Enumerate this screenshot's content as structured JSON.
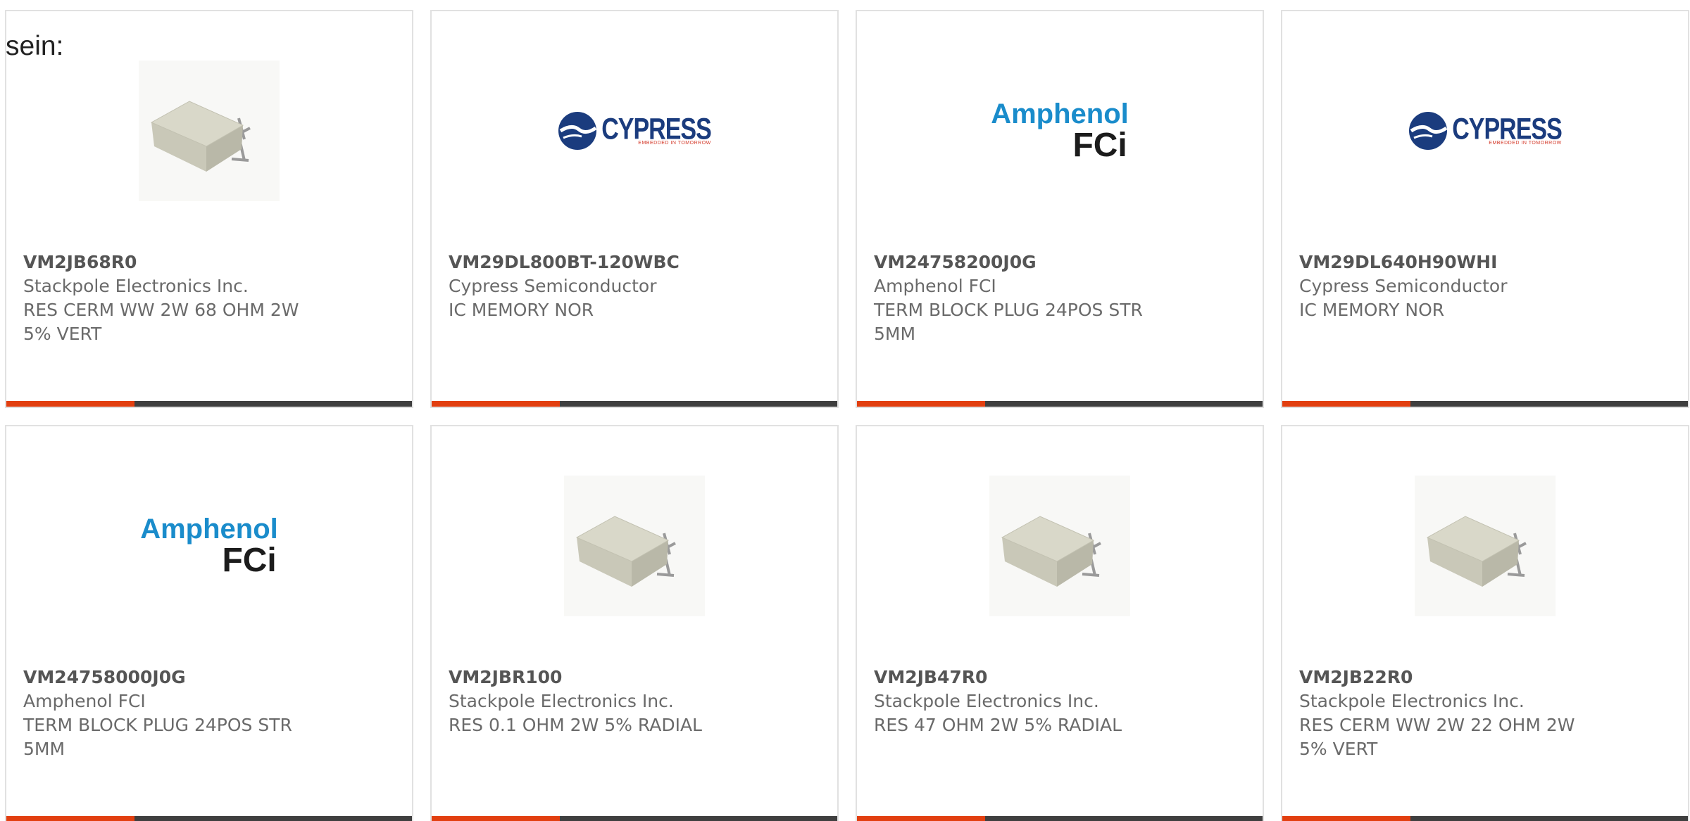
{
  "page": {
    "prefix_text": "sein:"
  },
  "colors": {
    "accent": "#e23f10",
    "bar": "#3f3f3f",
    "part_text": "#555555",
    "meta_text": "#6a6a6a"
  },
  "products": [
    {
      "part": "VM2JB68R0",
      "manufacturer": "Stackpole Electronics Inc.",
      "description_line1": "RES CERM WW 2W 68 OHM 2W",
      "description_line2": "5% VERT",
      "image": "resistor-image"
    },
    {
      "part": "VM29DL800BT-120WBC",
      "manufacturer": "Cypress Semiconductor",
      "description_line1": "IC MEMORY NOR",
      "description_line2": "",
      "image": "cypress-logo",
      "logo_word": "CYPRESS",
      "logo_tag": "EMBEDDED IN TOMORROW"
    },
    {
      "part": "VM24758200J0G",
      "manufacturer": "Amphenol FCI",
      "description_line1": "TERM BLOCK PLUG 24POS STR",
      "description_line2": "5MM",
      "image": "amphenol-fci-logo",
      "logo_brand": "Amphenol",
      "logo_sub": "FCi"
    },
    {
      "part": "VM29DL640H90WHI",
      "manufacturer": "Cypress Semiconductor",
      "description_line1": "IC MEMORY NOR",
      "description_line2": "",
      "image": "cypress-logo",
      "logo_word": "CYPRESS",
      "logo_tag": "EMBEDDED IN TOMORROW"
    },
    {
      "part": "VM24758000J0G",
      "manufacturer": "Amphenol FCI",
      "description_line1": "TERM BLOCK PLUG 24POS STR",
      "description_line2": "5MM",
      "image": "amphenol-fci-logo",
      "logo_brand": "Amphenol",
      "logo_sub": "FCi"
    },
    {
      "part": "VM2JBR100",
      "manufacturer": "Stackpole Electronics Inc.",
      "description_line1": "RES 0.1 OHM 2W 5% RADIAL",
      "description_line2": "",
      "image": "resistor-image"
    },
    {
      "part": "VM2JB47R0",
      "manufacturer": "Stackpole Electronics Inc.",
      "description_line1": "RES 47 OHM 2W 5% RADIAL",
      "description_line2": "",
      "image": "resistor-image"
    },
    {
      "part": "VM2JB22R0",
      "manufacturer": "Stackpole Electronics Inc.",
      "description_line1": "RES CERM WW 2W 22 OHM 2W",
      "description_line2": "5% VERT",
      "image": "resistor-image"
    }
  ]
}
